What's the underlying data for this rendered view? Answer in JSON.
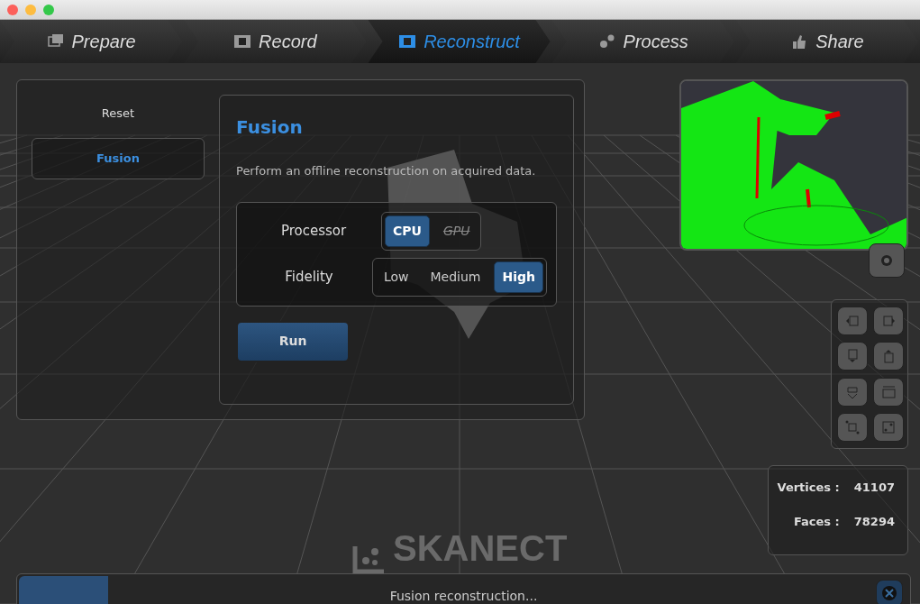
{
  "tabs": [
    {
      "label": "Prepare",
      "selected": false
    },
    {
      "label": "Record",
      "selected": false
    },
    {
      "label": "Reconstruct",
      "selected": true
    },
    {
      "label": "Process",
      "selected": false
    },
    {
      "label": "Share",
      "selected": false
    }
  ],
  "sidebar": {
    "items": [
      {
        "label": "Reset",
        "selected": false
      },
      {
        "label": "Fusion",
        "selected": true
      }
    ]
  },
  "panel": {
    "title": "Fusion",
    "description": "Perform an offline reconstruction on acquired data.",
    "options": [
      {
        "label": "Processor",
        "choices": [
          {
            "label": "CPU",
            "selected": true,
            "disabled": false
          },
          {
            "label": "GPU",
            "selected": false,
            "disabled": true
          }
        ]
      },
      {
        "label": "Fidelity",
        "choices": [
          {
            "label": "Low",
            "selected": false,
            "disabled": false
          },
          {
            "label": "Medium",
            "selected": false,
            "disabled": false
          },
          {
            "label": "High",
            "selected": true,
            "disabled": false
          }
        ]
      }
    ],
    "run_button": "Run"
  },
  "stats": [
    {
      "label": "Vertices :",
      "value": "41107"
    },
    {
      "label": "Faces :",
      "value": "78294"
    }
  ],
  "logo": "SKANECT",
  "status_bar": {
    "text": "Fusion reconstruction...",
    "level": 0.1
  }
}
